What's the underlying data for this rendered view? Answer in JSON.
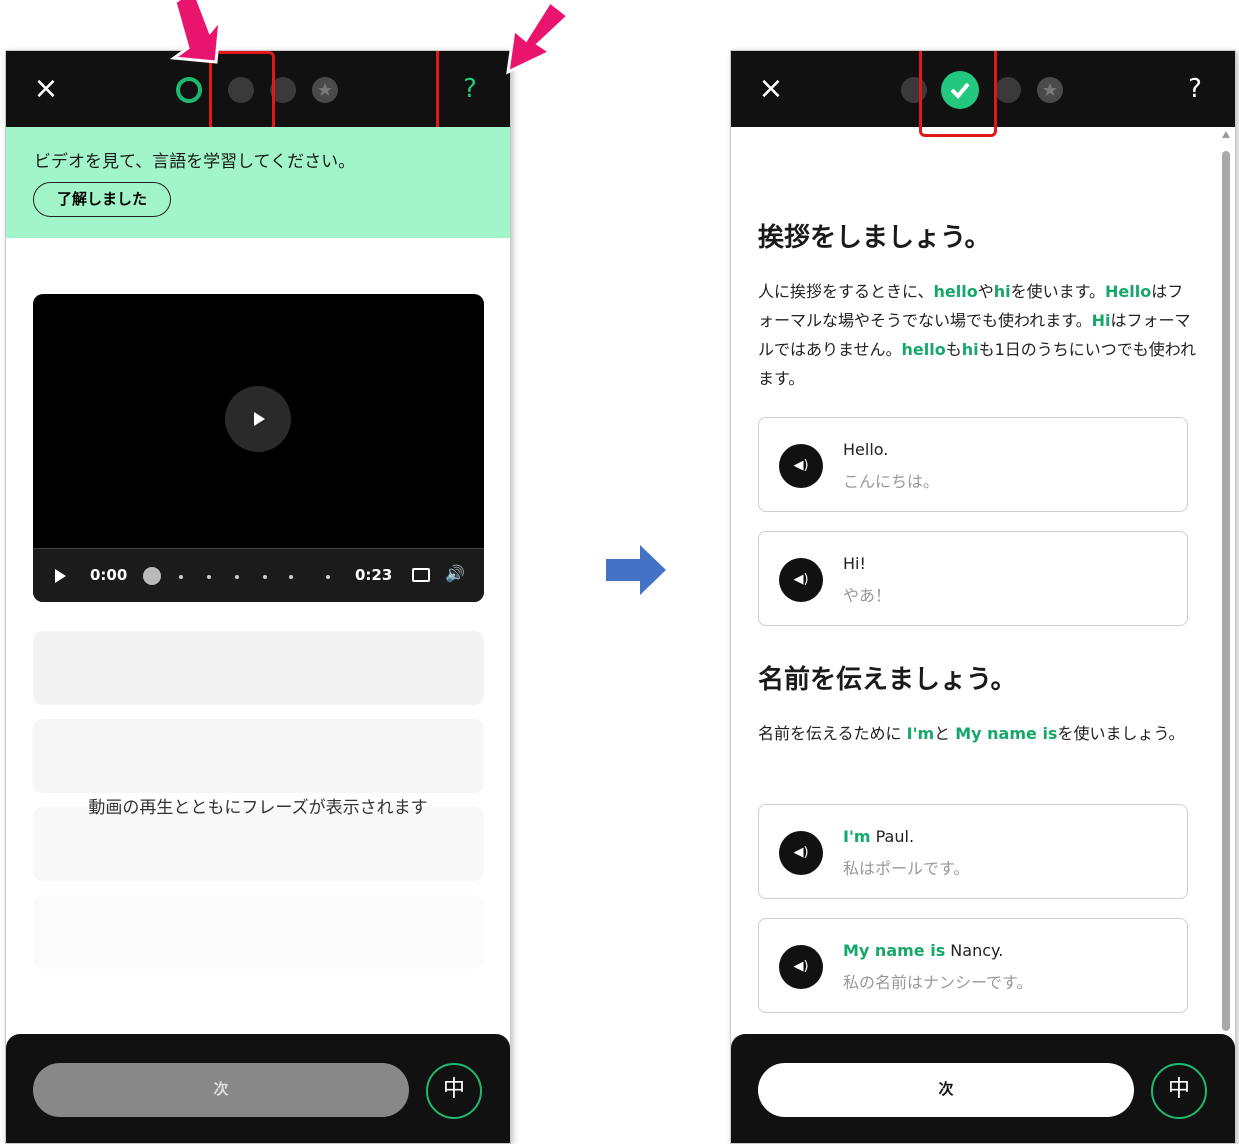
{
  "left_screen": {
    "close_icon": "×",
    "help_icon": "?",
    "progress": {
      "current_step": 1,
      "total_steps": 4
    },
    "tip": {
      "text": "ビデオを見て、言語を学習してください。",
      "button": "了解しました"
    },
    "video": {
      "current_time": "0:00",
      "duration": "0:23",
      "progress": 0
    },
    "phrase_note": "動画の再生とともにフレーズが表示されます",
    "next_label": "次",
    "lang_icon": "中"
  },
  "right_screen": {
    "close_icon": "×",
    "help_icon": "?",
    "progress": {
      "completed_steps": 1,
      "total_steps": 4
    },
    "section1": {
      "heading": "挨拶をしましょう。",
      "para": [
        {
          "t": "人に挨拶をするときに、"
        },
        {
          "t": "hello",
          "hl": true
        },
        {
          "t": "や"
        },
        {
          "t": "hi",
          "hl": true
        },
        {
          "t": "を使います。"
        },
        {
          "t": "Hello",
          "hl": true
        },
        {
          "t": "はフォーマルな場やそうでない場でも使われます。"
        },
        {
          "t": "Hi",
          "hl": true
        },
        {
          "t": "はフォーマルではありません。"
        },
        {
          "t": "hello",
          "hl": true
        },
        {
          "t": "も"
        },
        {
          "t": "hi",
          "hl": true
        },
        {
          "t": "も1日のうちにいつでも使われます。"
        }
      ],
      "cards": [
        {
          "en_hl": "",
          "en": "Hello.",
          "ja": "こんにちは。"
        },
        {
          "en_hl": "",
          "en": "Hi!",
          "ja": "やあ！"
        }
      ]
    },
    "section2": {
      "heading": "名前を伝えましょう。",
      "para": [
        {
          "t": "名前を伝えるために "
        },
        {
          "t": "I'm",
          "hl": true
        },
        {
          "t": "と "
        },
        {
          "t": "My name is",
          "hl": true
        },
        {
          "t": "を使いましょう。"
        }
      ],
      "cards": [
        {
          "en_hl": "I'm",
          "en": " Paul.",
          "ja": "私はポールです。"
        },
        {
          "en_hl": "My name is",
          "en": " Nancy.",
          "ja": "私の名前はナンシーです。"
        }
      ]
    },
    "next_label": "次",
    "lang_icon": "中"
  },
  "colors": {
    "accent_green": "#22c87d",
    "highlight_red": "#e01818",
    "arrow_pink": "#e8146e",
    "arrow_blue": "#4472c4"
  },
  "icons": [
    "close-icon",
    "help-icon",
    "play-icon",
    "captions-icon",
    "volume-icon",
    "audio-icon",
    "check-icon",
    "star-icon",
    "language-icon"
  ]
}
